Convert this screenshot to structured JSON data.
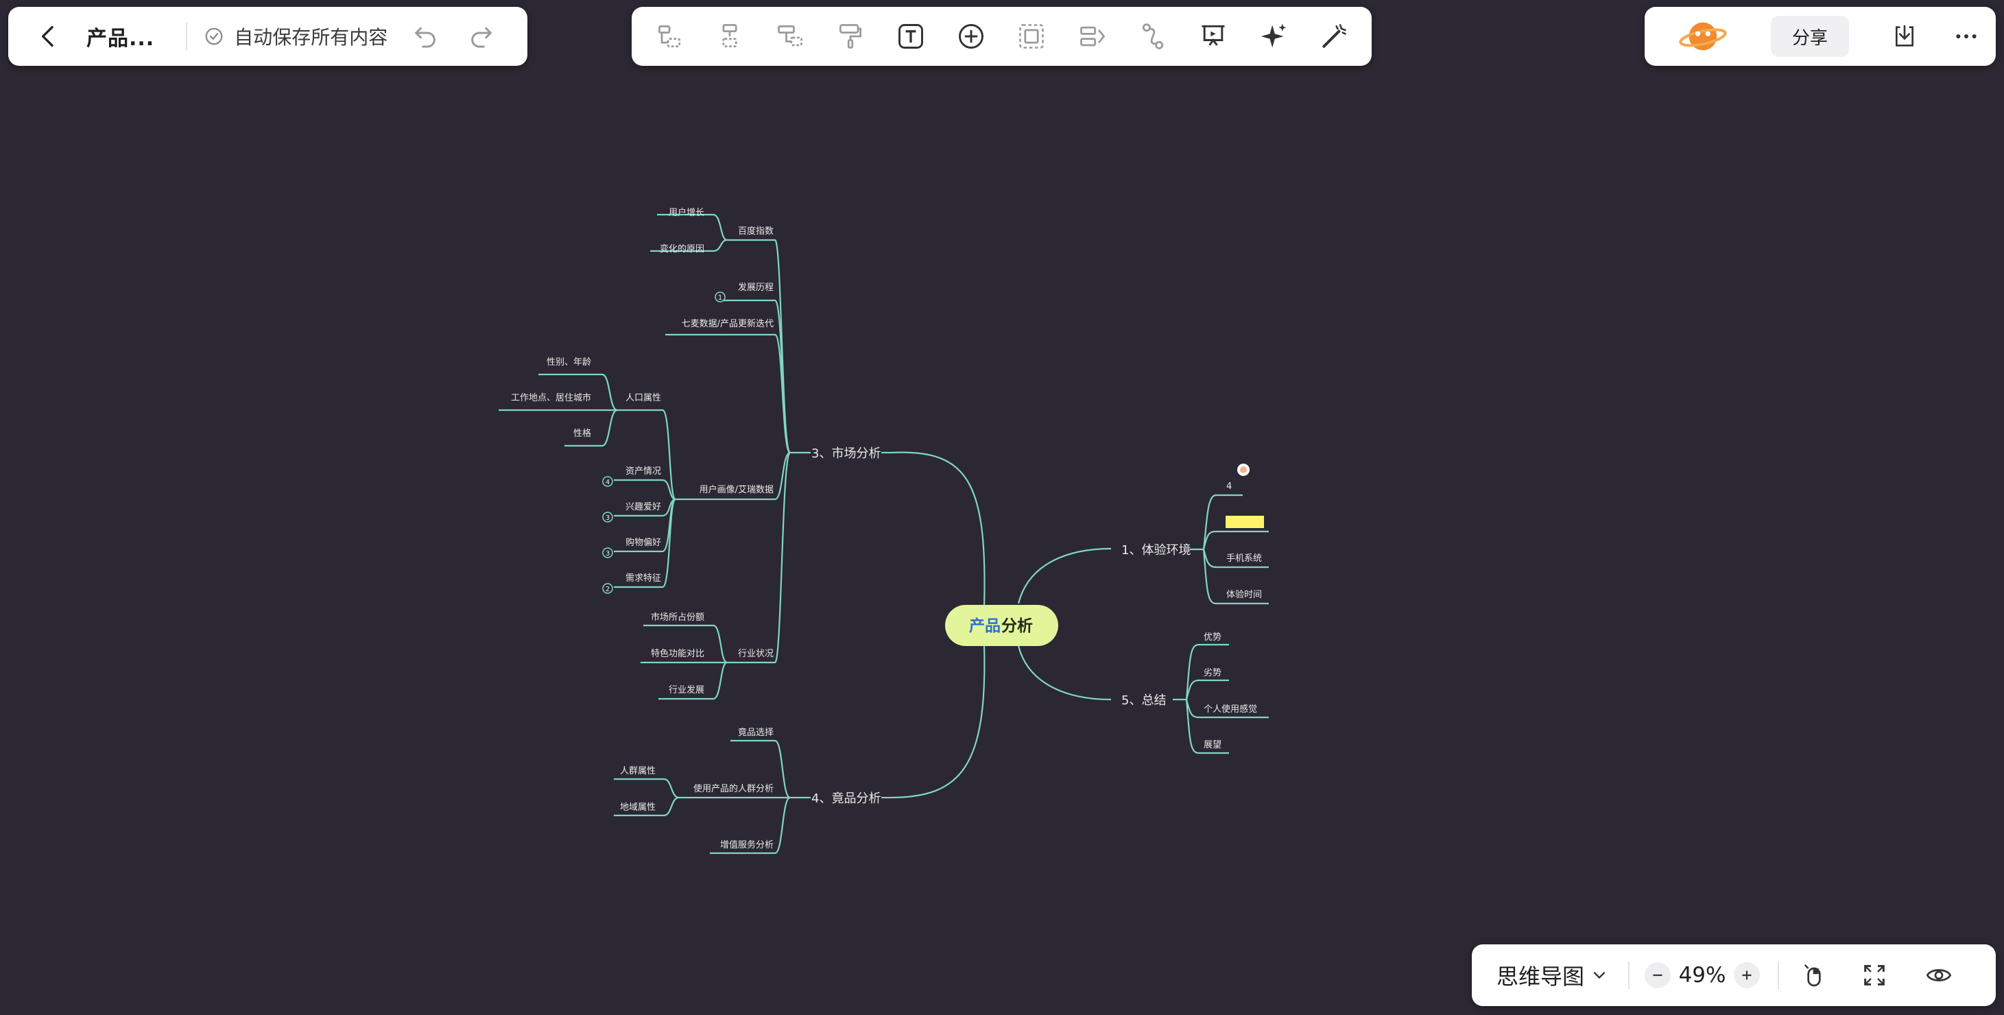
{
  "header": {
    "doc_title": "产品...",
    "save_status": "自动保存所有内容",
    "share_label": "分享"
  },
  "toolbar": {
    "tools": [
      "insert-sibling-icon",
      "insert-child-icon",
      "insert-parent-icon",
      "format-painter-icon",
      "text-icon",
      "add-icon",
      "summary-icon",
      "outline-relation-icon",
      "connector-icon",
      "presentation-icon",
      "ai-sparkle-icon",
      "magic-wand-icon"
    ]
  },
  "bottom": {
    "mode": "思维导图",
    "zoom": "49%"
  },
  "mindmap": {
    "root_part1": "产品",
    "root_part2": "分析",
    "branches": {
      "b1": {
        "label": "1、体验环境",
        "children": [
          "4",
          "",
          "手机系统",
          "体验时间"
        ]
      },
      "b5": {
        "label": "5、总结",
        "children": [
          "优势",
          "劣势",
          "个人使用感觉",
          "展望"
        ]
      },
      "b3": {
        "label": "3、市场分析",
        "baidu": {
          "label": "百度指数",
          "children": [
            "用户增长",
            "变化的原因"
          ]
        },
        "history": {
          "label": "发展历程",
          "badge": "1"
        },
        "qimai": {
          "label": "七麦数据/产品更新迭代"
        },
        "persona": {
          "label": "用户画像/艾瑞数据",
          "population": {
            "label": "人口属性",
            "children": [
              "性别、年龄",
              "工作地点、居住城市",
              "性格"
            ]
          },
          "others": [
            {
              "label": "资产情况",
              "badge": "4"
            },
            {
              "label": "兴趣爱好",
              "badge": "3"
            },
            {
              "label": "购物偏好",
              "badge": "3"
            },
            {
              "label": "需求特征",
              "badge": "2"
            }
          ]
        },
        "industry": {
          "label": "行业状况",
          "children": [
            "市场所占份额",
            "特色功能对比",
            "行业发展"
          ]
        }
      },
      "b4": {
        "label": "4、竟品分析",
        "select": "竟品选择",
        "users": {
          "label": "使用产品的人群分析",
          "children": [
            "人群属性",
            "地域属性"
          ]
        },
        "value_added": "增值服务分析"
      }
    }
  },
  "colors": {
    "background": "#2b2833",
    "line": "#7fd6c5",
    "root_fill": "#e3f59a",
    "root_text_1": "#2f6fd6",
    "root_text_2": "#1f2a1a",
    "highlight": "#fff36b",
    "accent_logo": "#f28a2e"
  }
}
